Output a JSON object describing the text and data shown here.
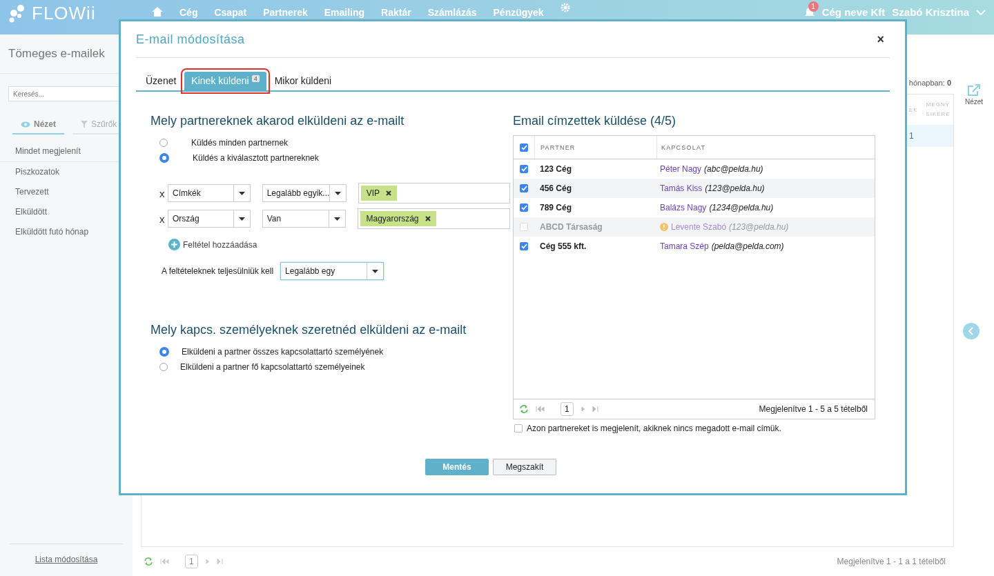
{
  "navbar": {
    "logo": "FLOWii",
    "items": [
      "Cég",
      "Csapat",
      "Partnerek",
      "Emailing",
      "Raktár",
      "Számlázás",
      "Pénzügyek"
    ],
    "notification_count": "1",
    "company": "Cég neve Kft",
    "user": "Szabó Krisztina"
  },
  "sidebar": {
    "title": "Tömeges e-mailek",
    "search": {
      "placeholder": "Keresés..."
    },
    "tabs": [
      {
        "label": "Nézet",
        "selected": true
      },
      {
        "label": "Szűrők",
        "selected": false
      }
    ],
    "items": [
      "Mindet megjelenít",
      "Piszkozatok",
      "Tervezett",
      "Elküldött",
      "Elküldött futó hónap"
    ],
    "footer_link": "Lista módosítása"
  },
  "main": {
    "summary_label": "hónapban:",
    "summary_value": "0",
    "columns": [
      "EK",
      "MEGNY SIKERE"
    ],
    "cell": "1",
    "pager_page": "1",
    "pager_info": "Megjelenítve 1 - 1 a 1 tételből",
    "view_label": "Nézet"
  },
  "dialog": {
    "title": "E-mail módosítása",
    "close": "×",
    "tabs": [
      {
        "label": "Üzenet",
        "selected": false
      },
      {
        "label": "Kinek küldeni",
        "badge": "4",
        "selected": true
      },
      {
        "label": "Mikor küldeni",
        "selected": false
      }
    ],
    "partners_heading": "Mely partnereknek akarod elküldeni az e-mailt",
    "partner_options": [
      {
        "label": "Küldés minden partnernek",
        "selected": false
      },
      {
        "label": "Küldés a kiválasztott partnereknek",
        "selected": true
      }
    ],
    "conditions": [
      {
        "remove": "x",
        "field": "Címkék",
        "operator": "Legalább egyik...",
        "tags": [
          "VIP"
        ]
      },
      {
        "remove": "x",
        "field": "Ország",
        "operator": "Van",
        "tags": [
          "Magyarország"
        ]
      }
    ],
    "add_condition": "Feltétel hozzáadása",
    "match_label": "A feltételeknek teljesülniük kell",
    "match_value": "Legalább egy",
    "contacts_heading": "Mely kapcs. személyeknek szeretnéd elküldeni az e-mailt",
    "contact_options": [
      {
        "label": "Elküldeni a partner összes kapcsolattartó személyének",
        "selected": true
      },
      {
        "label": "Elküldeni a partner fő kapcsolattartó személyeinek",
        "selected": false
      }
    ],
    "recipients": {
      "heading": "Email címzettek küldése (4/5)",
      "all_checked": true,
      "columns": [
        "PARTNER",
        "KAPCSOLAT"
      ],
      "rows": [
        {
          "partner": "123 Cég",
          "contact": "Péter Nagy",
          "email": "(abc@pelda.hu)",
          "checked": true,
          "disabled": false
        },
        {
          "partner": "456 Cég",
          "contact": "Tamás Kiss",
          "email": "(123@pelda.hu)",
          "checked": true,
          "disabled": false
        },
        {
          "partner": "789 Cég",
          "contact": "Balázs Nagy",
          "email": "(1234@pelda.hu)",
          "checked": true,
          "disabled": false
        },
        {
          "partner": "ABCD Társaság",
          "contact": "Levente Szabó",
          "email": "(123@pelda.hu)",
          "checked": false,
          "disabled": true
        },
        {
          "partner": "Cég 555 kft.",
          "contact": "Tamara Szép",
          "email": "(pelda@pelda.com)",
          "checked": true,
          "disabled": false
        }
      ],
      "pager_page": "1",
      "pager_info": "Megjelenítve 1 - 5 a 5 tételből"
    },
    "show_without_email": {
      "label": "Azon partnereket is megjelenít, akiknek nincs megadott e-mail címük.",
      "checked": false
    },
    "buttons": [
      "Mentés",
      "Megszakít"
    ]
  }
}
